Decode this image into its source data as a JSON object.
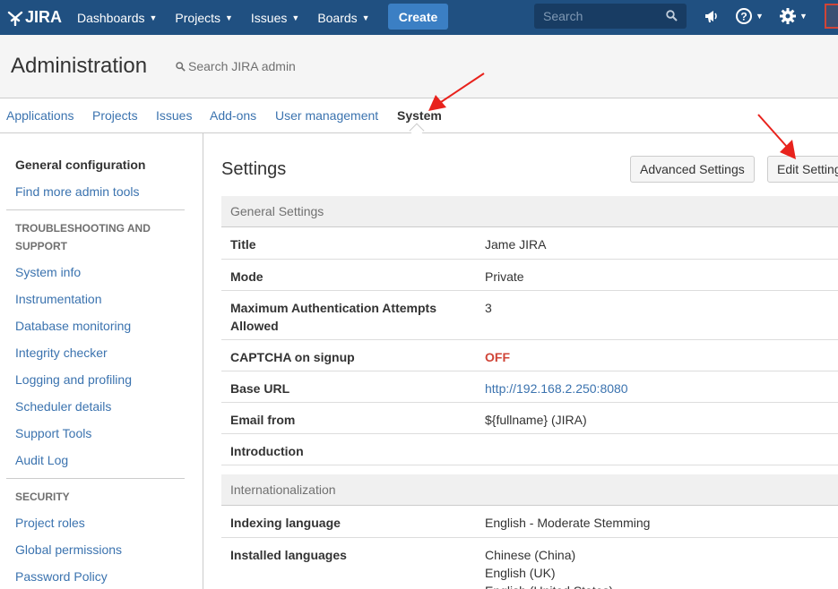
{
  "topnav": {
    "logo_text": "JIRA",
    "items": [
      {
        "label": "Dashboards"
      },
      {
        "label": "Projects"
      },
      {
        "label": "Issues"
      },
      {
        "label": "Boards"
      }
    ],
    "create_label": "Create",
    "search_placeholder": "Search",
    "brand_color": "#205081",
    "icons": [
      "announcement-icon",
      "help-icon",
      "gear-icon"
    ]
  },
  "admin": {
    "title": "Administration",
    "search_label": "Search JIRA admin"
  },
  "tabs": [
    {
      "label": "Applications"
    },
    {
      "label": "Projects"
    },
    {
      "label": "Issues"
    },
    {
      "label": "Add-ons"
    },
    {
      "label": "User management"
    },
    {
      "label": "System",
      "active": true
    }
  ],
  "sidebar": {
    "top_items": [
      {
        "label": "General configuration",
        "active": true
      },
      {
        "label": "Find more admin tools"
      }
    ],
    "troubleshooting_heading": "TROUBLESHOOTING AND SUPPORT",
    "troubleshooting_items": [
      {
        "label": "System info"
      },
      {
        "label": "Instrumentation"
      },
      {
        "label": "Database monitoring"
      },
      {
        "label": "Integrity checker"
      },
      {
        "label": "Logging and profiling"
      },
      {
        "label": "Scheduler details"
      },
      {
        "label": "Support Tools"
      },
      {
        "label": "Audit Log"
      }
    ],
    "security_heading": "SECURITY",
    "security_items": [
      {
        "label": "Project roles"
      },
      {
        "label": "Global permissions"
      },
      {
        "label": "Password Policy"
      }
    ]
  },
  "main": {
    "title": "Settings",
    "advanced_settings_label": "Advanced Settings",
    "edit_settings_label": "Edit Settings",
    "general_heading": "General Settings",
    "general_rows": [
      {
        "key": "Title",
        "value": "Jame JIRA"
      },
      {
        "key": "Mode",
        "value": "Private"
      },
      {
        "key": "Maximum Authentication Attempts Allowed",
        "value": "3"
      },
      {
        "key": "CAPTCHA on signup",
        "value": "OFF"
      },
      {
        "key": "Base URL",
        "value": "http://192.168.2.250:8080"
      },
      {
        "key": "Email from",
        "value": "${fullname} (JIRA)"
      },
      {
        "key": "Introduction",
        "value": ""
      }
    ],
    "intl_heading": "Internationalization",
    "intl_rows": [
      {
        "key": "Indexing language",
        "value": "English - Moderate Stemming"
      },
      {
        "key": "Installed languages",
        "values": [
          "Chinese (China)",
          "English (UK)",
          "English (United States)"
        ]
      }
    ]
  },
  "colors": {
    "link": "#3b73af",
    "off": "#d04437",
    "annotation_arrow": "#e8221c"
  }
}
